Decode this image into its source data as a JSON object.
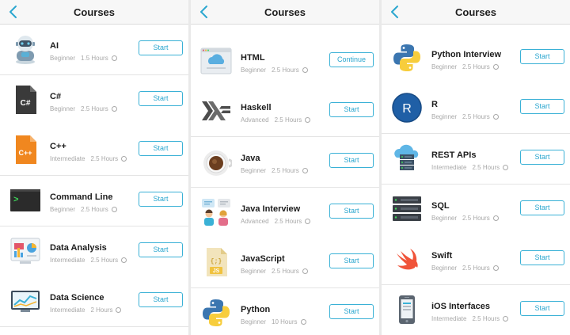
{
  "screens": [
    {
      "title": "Courses",
      "courses": [
        {
          "name": "AI",
          "level": "Beginner",
          "duration": "1.5 Hours",
          "action": "Start",
          "icon": "robot-icon"
        },
        {
          "name": "C#",
          "level": "Beginner",
          "duration": "2.5 Hours",
          "action": "Start",
          "icon": "csharp-file-icon"
        },
        {
          "name": "C++",
          "level": "Intermediate",
          "duration": "2.5 Hours",
          "action": "Start",
          "icon": "cpp-file-icon"
        },
        {
          "name": "Command Line",
          "level": "Beginner",
          "duration": "2.5 Hours",
          "action": "Start",
          "icon": "terminal-icon"
        },
        {
          "name": "Data Analysis",
          "level": "Intermediate",
          "duration": "2.5 Hours",
          "action": "Start",
          "icon": "data-analysis-icon"
        },
        {
          "name": "Data Science",
          "level": "Intermediate",
          "duration": "2 Hours",
          "action": "Start",
          "icon": "data-science-icon"
        }
      ]
    },
    {
      "title": "Courses",
      "courses": [
        {
          "name": "HTML",
          "level": "Beginner",
          "duration": "2.5 Hours",
          "action": "Continue",
          "icon": "html-browser-icon"
        },
        {
          "name": "Haskell",
          "level": "Advanced",
          "duration": "2.5 Hours",
          "action": "Start",
          "icon": "haskell-icon"
        },
        {
          "name": "Java",
          "level": "Beginner",
          "duration": "2.5 Hours",
          "action": "Start",
          "icon": "java-coffee-icon"
        },
        {
          "name": "Java Interview",
          "level": "Advanced",
          "duration": "2.5 Hours",
          "action": "Start",
          "icon": "interview-icon"
        },
        {
          "name": "JavaScript",
          "level": "Beginner",
          "duration": "2.5 Hours",
          "action": "Start",
          "icon": "javascript-file-icon"
        },
        {
          "name": "Python",
          "level": "Beginner",
          "duration": "10 Hours",
          "action": "Start",
          "icon": "python-icon"
        }
      ]
    },
    {
      "title": "Courses",
      "courses": [
        {
          "name": "Python Interview",
          "level": "Beginner",
          "duration": "2.5 Hours",
          "action": "Start",
          "icon": "python-icon"
        },
        {
          "name": "R",
          "level": "Beginner",
          "duration": "2.5 Hours",
          "action": "Start",
          "icon": "r-logo-icon"
        },
        {
          "name": "REST APIs",
          "level": "Intermediate",
          "duration": "2.5 Hours",
          "action": "Start",
          "icon": "cloud-server-icon"
        },
        {
          "name": "SQL",
          "level": "Beginner",
          "duration": "2.5 Hours",
          "action": "Start",
          "icon": "database-server-icon"
        },
        {
          "name": "Swift",
          "level": "Beginner",
          "duration": "2.5 Hours",
          "action": "Start",
          "icon": "swift-icon"
        },
        {
          "name": "iOS Interfaces",
          "level": "Intermediate",
          "duration": "2.5 Hours",
          "action": "Start",
          "icon": "phone-icon"
        }
      ]
    }
  ],
  "icon_labels": {
    "csharp": "C#",
    "cpp": "C++",
    "javascript": "JS",
    "javascript_braces": "{;}",
    "r": "R",
    "terminal": ">"
  },
  "colors": {
    "accent": "#3ab1d6",
    "header_bg": "#f7f7f7",
    "meta_text": "#a8a8a8"
  }
}
